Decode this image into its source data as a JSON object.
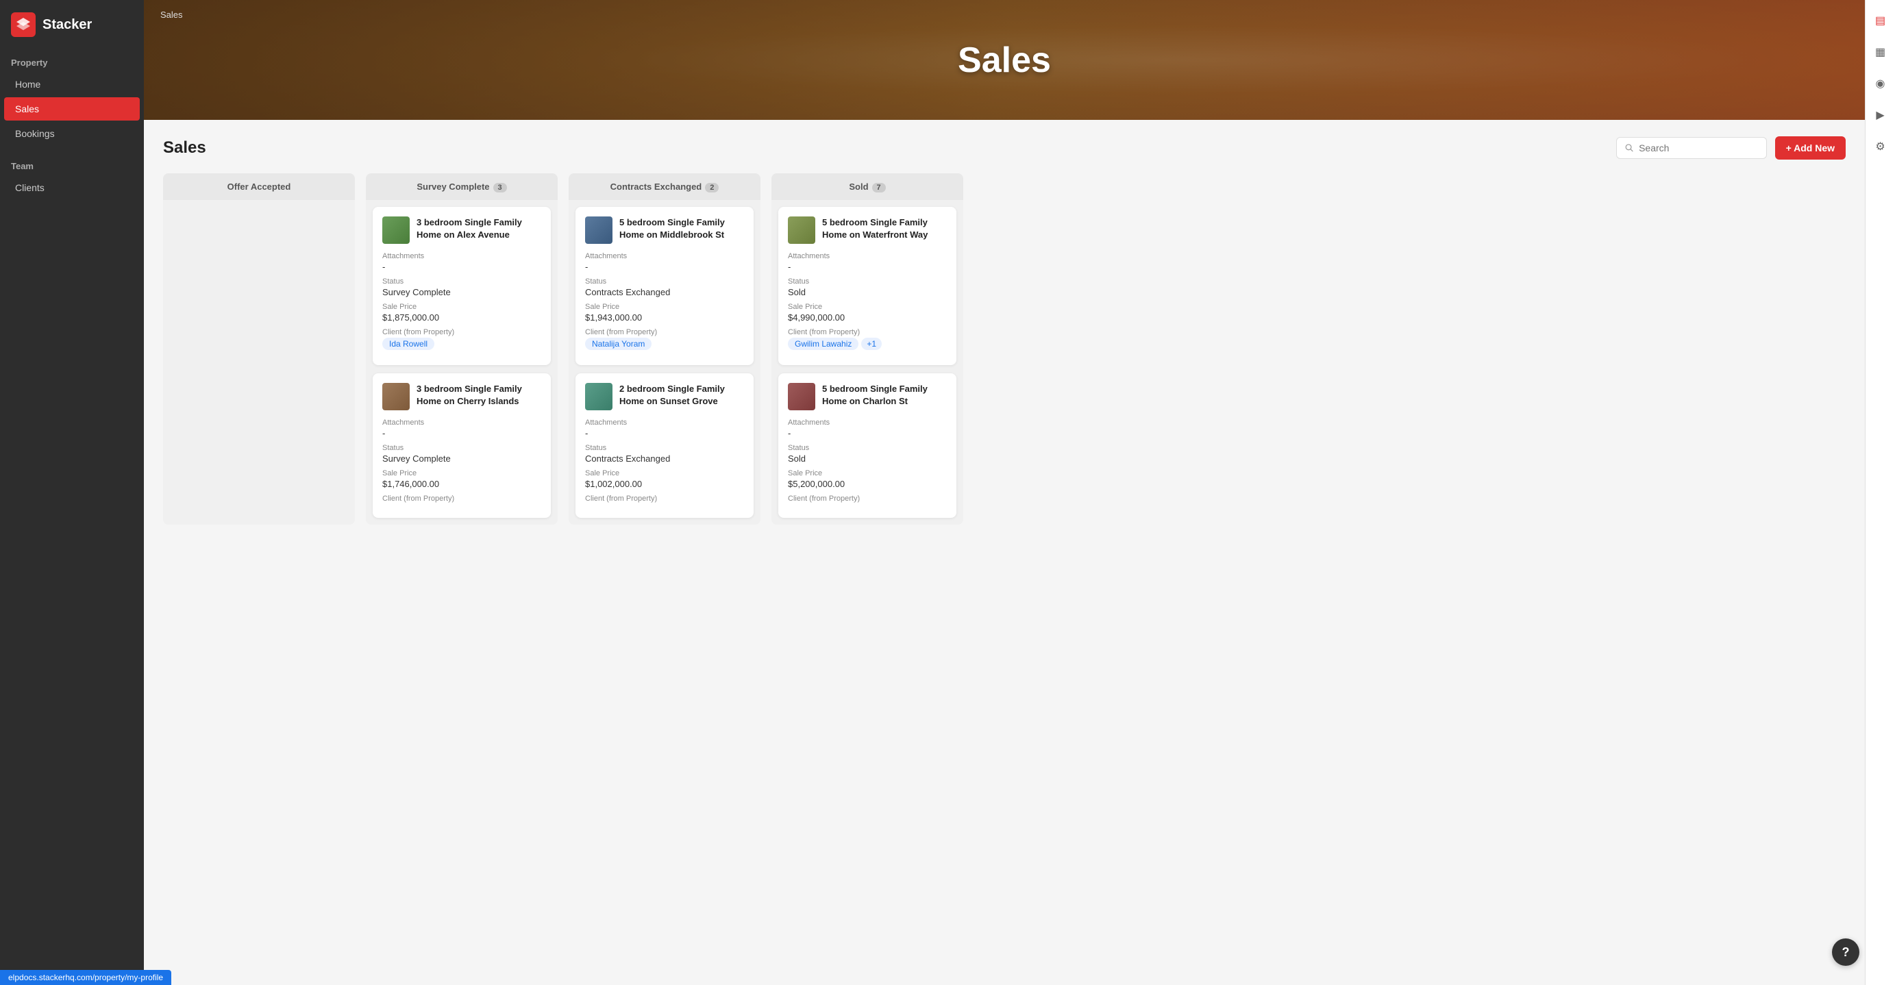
{
  "app": {
    "name": "Stacker"
  },
  "sidebar": {
    "property_label": "Property",
    "items": [
      {
        "id": "home",
        "label": "Home",
        "active": false
      },
      {
        "id": "sales",
        "label": "Sales",
        "active": true
      },
      {
        "id": "bookings",
        "label": "Bookings",
        "active": false
      }
    ],
    "team_label": "Team",
    "team_items": [
      {
        "id": "clients",
        "label": "Clients",
        "active": false
      }
    ]
  },
  "page": {
    "breadcrumb": "Sales",
    "title": "Sales",
    "search_placeholder": "Search",
    "add_new_label": "+ Add New"
  },
  "columns": [
    {
      "id": "offer-accepted",
      "label": "Offer Accepted",
      "badge": null,
      "cards": []
    },
    {
      "id": "survey-complete",
      "label": "Survey Complete",
      "badge": "3",
      "cards": [
        {
          "id": "sc1",
          "title": "3 bedroom Single Family Home on Alex Avenue",
          "thumb_class": "thumb-green",
          "attachments_label": "Attachments",
          "attachments_value": "-",
          "status_label": "Status",
          "status_value": "Survey Complete",
          "sale_price_label": "Sale Price",
          "sale_price_value": "$1,875,000.00",
          "client_label": "Client (from Property)",
          "clients": [
            {
              "name": "Ida Rowell"
            }
          ],
          "extra_count": null
        },
        {
          "id": "sc2",
          "title": "3 bedroom Single Family Home on Cherry Islands",
          "thumb_class": "thumb-brown",
          "attachments_label": "Attachments",
          "attachments_value": "-",
          "status_label": "Status",
          "status_value": "Survey Complete",
          "sale_price_label": "Sale Price",
          "sale_price_value": "$1,746,000.00",
          "client_label": "Client (from Property)",
          "clients": [],
          "extra_count": null
        }
      ]
    },
    {
      "id": "contracts-exchanged",
      "label": "Contracts Exchanged",
      "badge": "2",
      "cards": [
        {
          "id": "ce1",
          "title": "5 bedroom Single Family Home on Middlebrook St",
          "thumb_class": "thumb-blue",
          "attachments_label": "Attachments",
          "attachments_value": "-",
          "status_label": "Status",
          "status_value": "Contracts Exchanged",
          "sale_price_label": "Sale Price",
          "sale_price_value": "$1,943,000.00",
          "client_label": "Client (from Property)",
          "clients": [
            {
              "name": "Natalija Yoram"
            }
          ],
          "extra_count": null
        },
        {
          "id": "ce2",
          "title": "2 bedroom Single Family Home on Sunset Grove",
          "thumb_class": "thumb-teal",
          "attachments_label": "Attachments",
          "attachments_value": "-",
          "status_label": "Status",
          "status_value": "Contracts Exchanged",
          "sale_price_label": "Sale Price",
          "sale_price_value": "$1,002,000.00",
          "client_label": "Client (from Property)",
          "clients": [],
          "extra_count": null
        }
      ]
    },
    {
      "id": "sold",
      "label": "Sold",
      "badge": "7",
      "cards": [
        {
          "id": "s1",
          "title": "5 bedroom Single Family Home on Waterfront Way",
          "thumb_class": "thumb-olive",
          "attachments_label": "Attachments",
          "attachments_value": "-",
          "status_label": "Status",
          "status_value": "Sold",
          "sale_price_label": "Sale Price",
          "sale_price_value": "$4,990,000.00",
          "client_label": "Client (from Property)",
          "clients": [
            {
              "name": "Gwilim Lawahiz"
            }
          ],
          "extra_count": "+1"
        },
        {
          "id": "s2",
          "title": "5 bedroom Single Family Home on Charlon St",
          "thumb_class": "thumb-red",
          "attachments_label": "Attachments",
          "attachments_value": "-",
          "status_label": "Status",
          "status_value": "Sold",
          "sale_price_label": "Sale Price",
          "sale_price_value": "$5,200,000.00",
          "client_label": "Client (from Property)",
          "clients": [],
          "extra_count": null
        }
      ]
    }
  ],
  "right_sidebar": {
    "icons": [
      {
        "id": "filter-icon",
        "symbol": "▤",
        "active": true
      },
      {
        "id": "calendar-icon",
        "symbol": "▦",
        "active": false
      },
      {
        "id": "person-icon",
        "symbol": "◉",
        "active": false
      },
      {
        "id": "play-icon",
        "symbol": "▶",
        "active": false
      },
      {
        "id": "gear-icon",
        "symbol": "⚙",
        "active": false
      }
    ]
  },
  "help": {
    "label": "?"
  },
  "tooltip": {
    "url": "elpdocs.stackerhq.com/property/my-profile"
  }
}
